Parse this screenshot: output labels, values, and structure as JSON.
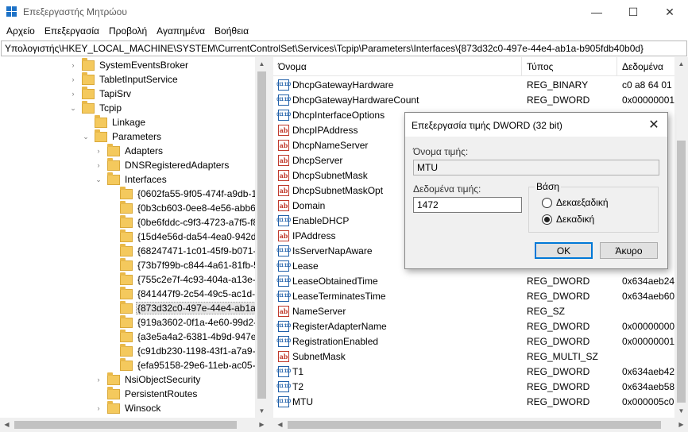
{
  "window": {
    "title": "Επεξεργαστής Μητρώου",
    "minimize": "—",
    "maximize": "☐",
    "close": "✕"
  },
  "menu": [
    "Αρχείο",
    "Επεξεργασία",
    "Προβολή",
    "Αγαπημένα",
    "Βοήθεια"
  ],
  "address": "Υπολογιστής\\HKEY_LOCAL_MACHINE\\SYSTEM\\CurrentControlSet\\Services\\Tcpip\\Parameters\\Interfaces\\{873d32c0-497e-44e4-ab1a-b905fdb40b0d}",
  "tree": [
    {
      "label": "SystemEventsBroker",
      "toggle": "›",
      "depth": 0
    },
    {
      "label": "TabletInputService",
      "toggle": "›",
      "depth": 0
    },
    {
      "label": "TapiSrv",
      "toggle": "›",
      "depth": 0
    },
    {
      "label": "Tcpip",
      "toggle": "⌄",
      "depth": 0
    },
    {
      "label": "Linkage",
      "toggle": "",
      "depth": 1
    },
    {
      "label": "Parameters",
      "toggle": "⌄",
      "depth": 1
    },
    {
      "label": "Adapters",
      "toggle": "›",
      "depth": 2
    },
    {
      "label": "DNSRegisteredAdapters",
      "toggle": "›",
      "depth": 2
    },
    {
      "label": "Interfaces",
      "toggle": "⌄",
      "depth": 2
    },
    {
      "label": "{0602fa55-9f05-474f-a9db-1f",
      "toggle": "",
      "depth": 3
    },
    {
      "label": "{0b3cb603-0ee8-4e56-abb6-",
      "toggle": "",
      "depth": 3
    },
    {
      "label": "{0be6fddc-c9f3-4723-a7f5-f8",
      "toggle": "",
      "depth": 3
    },
    {
      "label": "{15d4e56d-da54-4ea0-942d-l",
      "toggle": "",
      "depth": 3
    },
    {
      "label": "{68247471-1c01-45f9-b071-e",
      "toggle": "",
      "depth": 3
    },
    {
      "label": "{73b7f99b-c844-4a61-81fb-5",
      "toggle": "",
      "depth": 3
    },
    {
      "label": "{755c2e7f-4c93-404a-a13e-d",
      "toggle": "",
      "depth": 3
    },
    {
      "label": "{841447f9-2c54-49c5-ac1d-2",
      "toggle": "",
      "depth": 3
    },
    {
      "label": "{873d32c0-497e-44e4-ab1a-b",
      "toggle": "",
      "depth": 3,
      "selected": true
    },
    {
      "label": "{919a3602-0f1a-4e60-99d2-f",
      "toggle": "",
      "depth": 3
    },
    {
      "label": "{a3e5a4a2-6381-4b9d-947e-1",
      "toggle": "",
      "depth": 3
    },
    {
      "label": "{c91db230-1198-43f1-a7a9-d",
      "toggle": "",
      "depth": 3
    },
    {
      "label": "{efa95158-29e6-11eb-ac05-8",
      "toggle": "",
      "depth": 3
    },
    {
      "label": "NsiObjectSecurity",
      "toggle": "›",
      "depth": 2
    },
    {
      "label": "PersistentRoutes",
      "toggle": "",
      "depth": 2
    },
    {
      "label": "Winsock",
      "toggle": "›",
      "depth": 2
    }
  ],
  "list": {
    "headers": [
      "Όνομα",
      "Τύπος",
      "Δεδομένα"
    ],
    "rows": [
      {
        "icon": "bin",
        "name": "DhcpGatewayHardware",
        "type": "REG_BINARY",
        "data": "c0 a8 64 01 0"
      },
      {
        "icon": "bin",
        "name": "DhcpGatewayHardwareCount",
        "type": "REG_DWORD",
        "data": "0x00000001 ("
      },
      {
        "icon": "bin",
        "name": "DhcpInterfaceOptions",
        "type": "",
        "data": ""
      },
      {
        "icon": "sz",
        "name": "DhcpIPAddress",
        "type": "",
        "data": ""
      },
      {
        "icon": "sz",
        "name": "DhcpNameServer",
        "type": "",
        "data": ""
      },
      {
        "icon": "sz",
        "name": "DhcpServer",
        "type": "",
        "data": ""
      },
      {
        "icon": "sz",
        "name": "DhcpSubnetMask",
        "type": "",
        "data": ""
      },
      {
        "icon": "sz",
        "name": "DhcpSubnetMaskOpt",
        "type": "",
        "data": ""
      },
      {
        "icon": "sz",
        "name": "Domain",
        "type": "",
        "data": ""
      },
      {
        "icon": "bin",
        "name": "EnableDHCP",
        "type": "",
        "data": ""
      },
      {
        "icon": "sz",
        "name": "IPAddress",
        "type": "",
        "data": ""
      },
      {
        "icon": "bin",
        "name": "IsServerNapAware",
        "type": "",
        "data": ""
      },
      {
        "icon": "bin",
        "name": "Lease",
        "type": "",
        "data": ""
      },
      {
        "icon": "bin",
        "name": "LeaseObtainedTime",
        "type": "REG_DWORD",
        "data": "0x634aeb24"
      },
      {
        "icon": "bin",
        "name": "LeaseTerminatesTime",
        "type": "REG_DWORD",
        "data": "0x634aeb60"
      },
      {
        "icon": "sz",
        "name": "NameServer",
        "type": "REG_SZ",
        "data": ""
      },
      {
        "icon": "bin",
        "name": "RegisterAdapterName",
        "type": "REG_DWORD",
        "data": "0x00000000 ("
      },
      {
        "icon": "bin",
        "name": "RegistrationEnabled",
        "type": "REG_DWORD",
        "data": "0x00000001 ("
      },
      {
        "icon": "sz",
        "name": "SubnetMask",
        "type": "REG_MULTI_SZ",
        "data": ""
      },
      {
        "icon": "bin",
        "name": "T1",
        "type": "REG_DWORD",
        "data": "0x634aeb42"
      },
      {
        "icon": "bin",
        "name": "T2",
        "type": "REG_DWORD",
        "data": "0x634aeb58"
      },
      {
        "icon": "bin",
        "name": "MTU",
        "type": "REG_DWORD",
        "data": "0x000005c0"
      }
    ]
  },
  "dialog": {
    "title": "Επεξεργασία τιμής DWORD (32 bit)",
    "close": "✕",
    "value_name_label": "Όνομα τιμής:",
    "value_name": "MTU",
    "value_data_label": "Δεδομένα τιμής:",
    "value_data": "1472",
    "base_label": "Βάση",
    "hex_label": "Δεκαεξαδική",
    "dec_label": "Δεκαδική",
    "selected_base": "dec",
    "ok": "ΟΚ",
    "cancel": "Άκυρο"
  }
}
